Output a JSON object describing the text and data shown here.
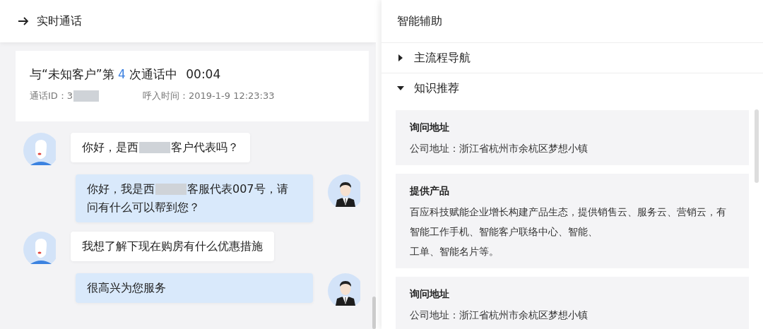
{
  "call_panel": {
    "title": "实时通话",
    "call_info": {
      "title_parts": [
        "与“未知客户”第",
        "4",
        "次通话中"
      ],
      "duration": "00:04",
      "call_id_label": "通话ID：",
      "call_id_visible": "3",
      "call_id_redacted": true,
      "incoming_time": "呼入时间：2019-1-9 12:23:33"
    },
    "messages": [
      {
        "kind": "customer",
        "segments": [
          {
            "kind": "text",
            "text": "你好，是西"
          },
          {
            "kind": "redacted"
          },
          {
            "kind": "text",
            "text": "客户代表吗？"
          }
        ]
      },
      {
        "kind": "agent",
        "segments": [
          {
            "kind": "text",
            "text": "你好，我是西"
          },
          {
            "kind": "redacted"
          },
          {
            "kind": "text",
            "text": "客服代表007号，请"
          },
          {
            "kind": "break"
          },
          {
            "kind": "text",
            "text": "问有什么可以帮到您？"
          }
        ]
      },
      {
        "kind": "customer",
        "segments": [
          {
            "kind": "text",
            "text": "我想了解下现在购房有什么优惠措施"
          }
        ]
      },
      {
        "kind": "agent",
        "segments": [
          {
            "kind": "text",
            "text": "很高兴为您服务"
          }
        ]
      }
    ]
  },
  "assist_panel": {
    "title": "智能辅助",
    "sections": [
      {
        "title": "主流程导航",
        "expanded": false
      },
      {
        "title": "知识推荐",
        "expanded": true,
        "cards": [
          {
            "title": "询问地址",
            "lines": [
              "公司地址：浙江省杭州市余杭区梦想小镇"
            ]
          },
          {
            "title": "提供产品",
            "lines": [
              "百应科技赋能企业增长构建产品生态，提供销售云、服务云、营销云，有智能工作手机、智能客户联络中心、智能、",
              "工单、智能名片等。"
            ]
          },
          {
            "title": "询问地址",
            "lines": [
              "公司地址：浙江省杭州市余杭区梦想小镇"
            ]
          }
        ]
      }
    ]
  }
}
